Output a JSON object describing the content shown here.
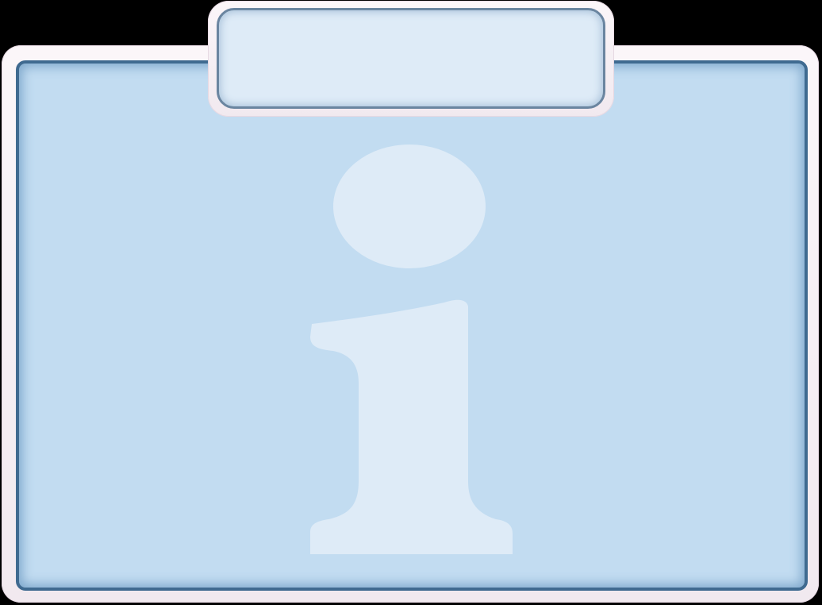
{
  "panel": {
    "title": "",
    "icon": "info-icon"
  },
  "colors": {
    "frame": "#f5eef3",
    "panel_fill": "#c2dcf1",
    "panel_border": "#3f6a90",
    "tab_fill": "#deebf7",
    "icon_fill": "#deebf7"
  }
}
